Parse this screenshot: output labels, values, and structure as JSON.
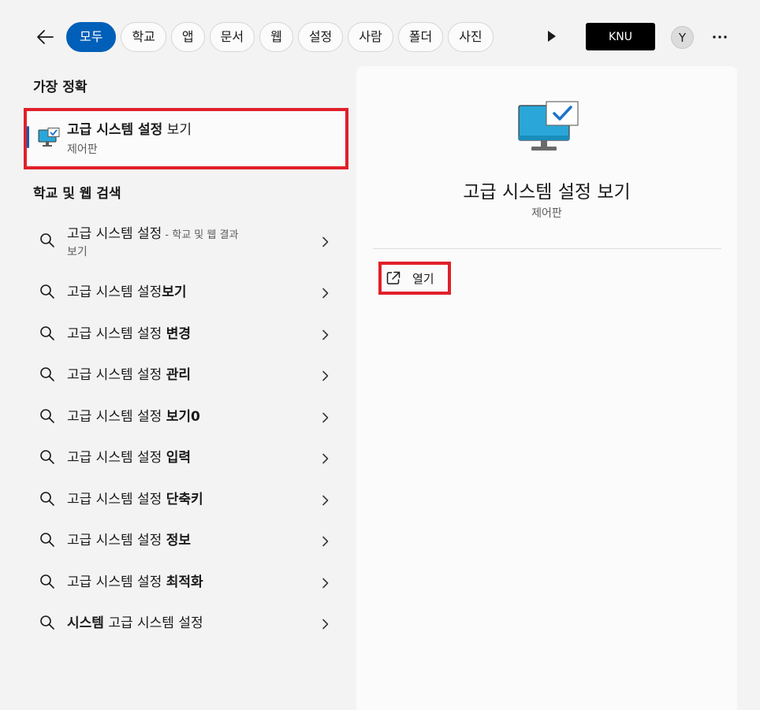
{
  "filters": [
    "모두",
    "학교",
    "앱",
    "문서",
    "웹",
    "설정",
    "사람",
    "폴더",
    "사진"
  ],
  "org_label": "KNU",
  "avatar_initial": "Y",
  "best_match": {
    "section_title": "가장 정확",
    "title_bold": "고급 시스템 설정",
    "title_rest": " 보기",
    "subtitle": "제어판"
  },
  "web_section_title": "학교 및 웹 검색",
  "results": [
    {
      "normal": "고급 시스템 설정",
      "bold": "",
      "suffix": " - 학교 및 웹 결과",
      "line2": "보기"
    },
    {
      "normal": "고급 시스템 설정",
      "bold": "보기",
      "suffix": "",
      "line2": ""
    },
    {
      "normal": "고급 시스템 설정 ",
      "bold": "변경",
      "suffix": "",
      "line2": ""
    },
    {
      "normal": "고급 시스템 설정 ",
      "bold": "관리",
      "suffix": "",
      "line2": ""
    },
    {
      "normal": "고급 시스템 설정 ",
      "bold": "보기0",
      "suffix": "",
      "line2": ""
    },
    {
      "normal": "고급 시스템 설정 ",
      "bold": "입력",
      "suffix": "",
      "line2": ""
    },
    {
      "normal": "고급 시스템 설정 ",
      "bold": "단축키",
      "suffix": "",
      "line2": ""
    },
    {
      "normal": "고급 시스템 설정 ",
      "bold": "정보",
      "suffix": "",
      "line2": ""
    },
    {
      "normal": "고급 시스템 설정 ",
      "bold": "최적화",
      "suffix": "",
      "line2": ""
    },
    {
      "normal": " 고급 시스템 설정",
      "bold": "시스템",
      "suffix": "",
      "line2": "",
      "bold_first": true
    }
  ],
  "detail": {
    "title": "고급 시스템 설정 보기",
    "subtitle": "제어판",
    "open_label": "열기"
  },
  "colors": {
    "accent": "#005fb8",
    "highlight": "#e0202a"
  }
}
